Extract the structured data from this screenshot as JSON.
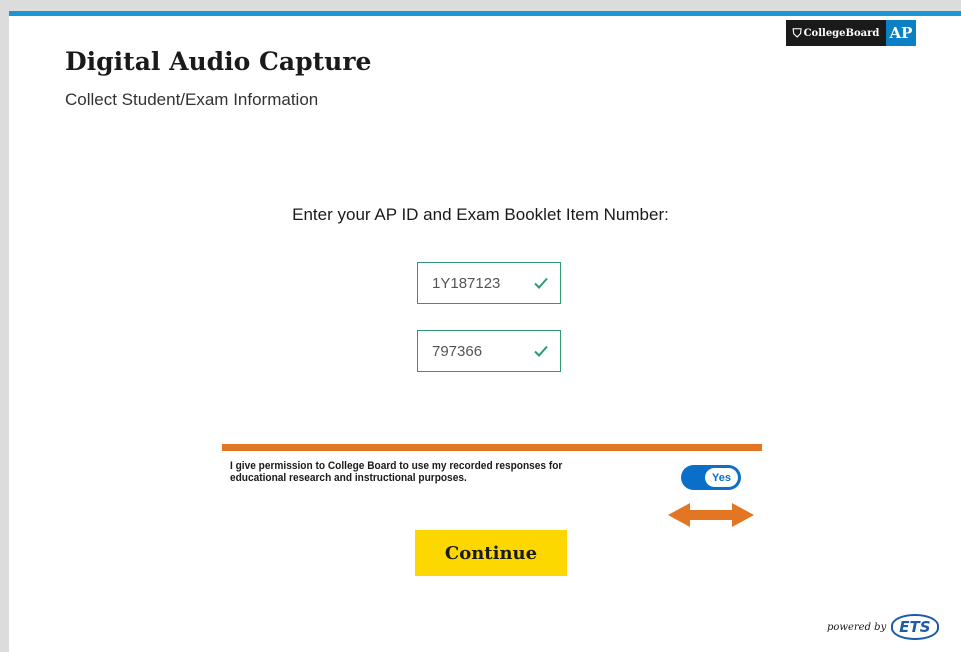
{
  "header": {
    "title": "Digital Audio Capture",
    "subtitle": "Collect Student/Exam Information"
  },
  "logo": {
    "collegeboard": "CollegeBoard",
    "ap": "AP"
  },
  "form": {
    "prompt": "Enter your AP ID and Exam Booklet Item Number:",
    "ap_id": "1Y187123",
    "booklet_number": "797366"
  },
  "consent": {
    "text": "I give permission to College Board to use my recorded responses for educational research and instructional purposes.",
    "toggle_label": "Yes"
  },
  "actions": {
    "continue_label": "Continue"
  },
  "footer": {
    "powered_by": "powered by",
    "ets": "ETS"
  },
  "colors": {
    "accent_blue": "#1a96d4",
    "valid_green": "#2e9a6e",
    "orange": "#e27623",
    "toggle_blue": "#0b6fc9",
    "button_yellow": "#fcd800"
  },
  "icons": {
    "check": "check-icon",
    "swap": "double-arrow-icon"
  }
}
